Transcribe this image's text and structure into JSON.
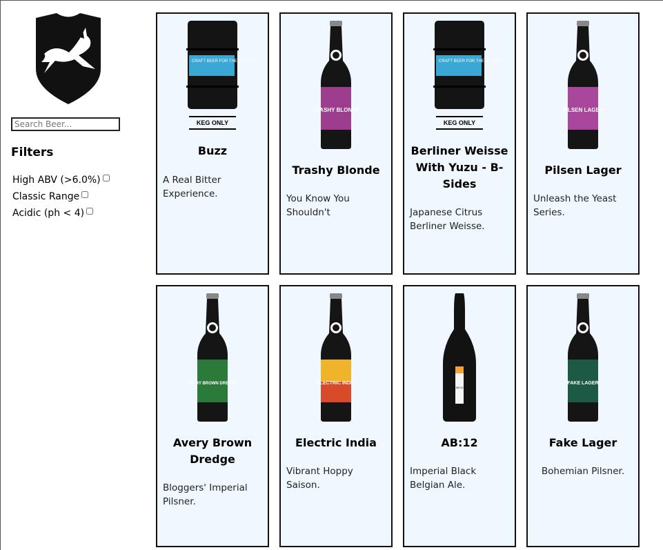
{
  "search": {
    "placeholder": "Search Beer..."
  },
  "filters": {
    "title": "Filters",
    "items": [
      {
        "label": "High ABV (>6.0%)",
        "checked": false
      },
      {
        "label": "Classic Range",
        "checked": false
      },
      {
        "label": "Acidic (ph < 4)",
        "checked": false
      }
    ]
  },
  "beers": [
    {
      "name": "Buzz",
      "tagline": "A Real Bitter Experience.",
      "image": "keg-icon",
      "keg_text": "CRAFT BEER FOR THE PEOPLE",
      "keg_only": "KEG ONLY"
    },
    {
      "name": "Trashy Blonde",
      "tagline": "You Know You Shouldn't",
      "image": "bottle-icon",
      "label_color": "#9c3d8e",
      "label_text": "TRASHY BLONDE"
    },
    {
      "name": "Berliner Weisse With Yuzu - B-Sides",
      "tagline": "Japanese Citrus Berliner Weisse.",
      "image": "keg-icon",
      "keg_text": "CRAFT BEER FOR THE PEOPLE",
      "keg_only": "KEG ONLY"
    },
    {
      "name": "Pilsen Lager",
      "tagline": "Unleash the Yeast Series.",
      "image": "bottle-icon",
      "label_color": "#a8479c",
      "label_text": "PILSEN LAGER"
    },
    {
      "name": "Avery Brown Dredge",
      "tagline": "Bloggers' Imperial Pilsner.",
      "image": "bottle-icon",
      "label_color": "#2c7a3a",
      "label_text": "AVERY BROWN DREDGE"
    },
    {
      "name": "Electric India",
      "tagline": "Vibrant Hoppy Saison.",
      "image": "bottle-icon",
      "label_color": "#d94a2a",
      "label_text": "ELECTRIC INDIA"
    },
    {
      "name": "AB:12",
      "tagline": "Imperial Black Belgian Ale.",
      "image": "champagne-bottle-icon",
      "label_color": "#f3a23a",
      "label_text": "AB:12"
    },
    {
      "name": "Fake Lager",
      "tagline": "Bohemian Pilsner.",
      "image": "bottle-icon",
      "label_color": "#1d5a45",
      "label_text": "FAKE LAGER"
    }
  ]
}
